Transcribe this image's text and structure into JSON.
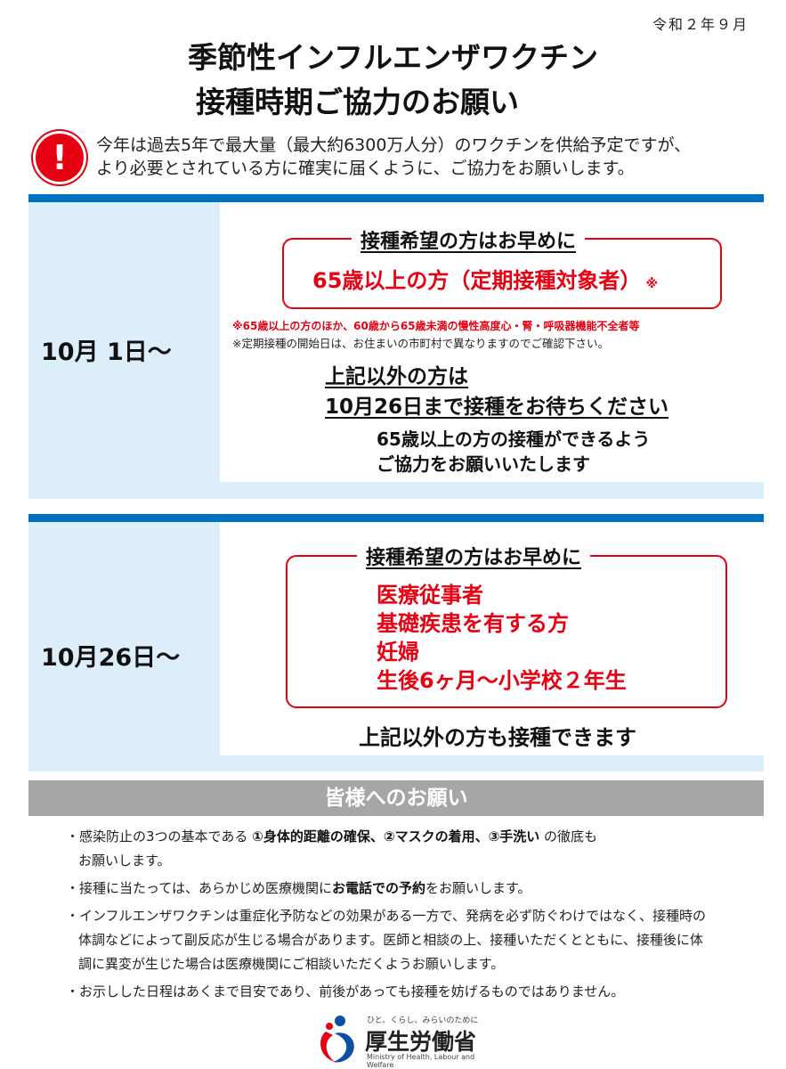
{
  "date": "令和２年９月",
  "title": {
    "line1": "季節性インフルエンザワクチン",
    "line2": "接種時期ご協力のお願い"
  },
  "intro": {
    "icon": "exclamation-icon",
    "line1": "今年は過去5年で最大量（最大約6300万人分）のワクチンを供給予定ですが、",
    "line2": "より必要とされている方に確実に届くように、ご協力をお願いします。"
  },
  "section1": {
    "date_label": "10月 1日～",
    "box_heading": "接種希望の方はお早めに",
    "target": "65歳以上の方（定期接種対象者）",
    "target_mark": "※",
    "note_red": "※65歳以上の方のほか、60歳から65歳未満の慢性高度心・腎・呼吸器機能不全者等",
    "note": "※定期接種の開始日は、お住まいの市町村で異なりますのでご確認下さい。",
    "others_line1": "上記以外の方は",
    "others_line2": "10月26日まで接種をお待ちください",
    "sub_line1": "65歳以上の方の接種ができるよう",
    "sub_line2": "ご協力をお願いいたします"
  },
  "section2": {
    "date_label": "10月26日～",
    "box_heading": "接種希望の方はお早めに",
    "targets": [
      "医療従事者",
      "基礎疾患を有する方",
      "妊婦",
      "生後6ヶ月～小学校２年生"
    ],
    "others": "上記以外の方も接種できます"
  },
  "requests": {
    "heading": "皆様へのお願い",
    "b1_pre": "・感染防止の3つの基本である ",
    "b1_bold": "①身体的距離の確保、②マスクの着用、③手洗い",
    "b1_post": " の徹底も",
    "b1_line2": "お願いします。",
    "b2_pre": "・接種に当たっては、あらかじめ医療機関に",
    "b2_bold": "お電話での予約",
    "b2_post": "をお願いします。",
    "b3_line1": "・インフルエンザワクチンは重症化予防などの効果がある一方で、発病を必ず防ぐわけではなく、接種時の",
    "b3_line2": "体調などによって副反応が生じる場合があります。医師と相談の上、接種いただくとともに、接種後に体",
    "b3_line3": "調に異変が生じた場合は医療機関にご相談いただくようお願いします。",
    "b4": "・お示しした日程はあくまで目安であり、前後があっても接種を妨げるものではありません。"
  },
  "logo": {
    "tagline": "ひと、くらし、みらいのために",
    "name": "厚生労働省",
    "english": "Ministry of Health, Labour and Welfare"
  },
  "colors": {
    "accent_blue": "#0070c0",
    "panel_blue": "#ddeefb",
    "alert_red": "#e60012",
    "header_gray": "#a6a6a6"
  }
}
